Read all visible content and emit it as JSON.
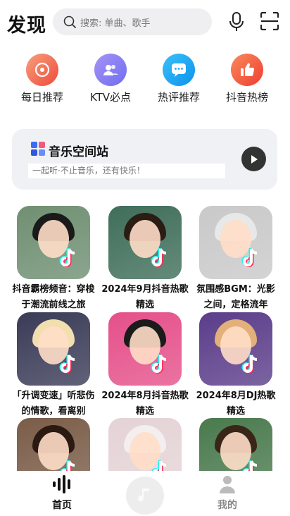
{
  "header": {
    "title": "发现",
    "search_placeholder": "搜索: 单曲、歌手"
  },
  "shortcuts": [
    {
      "label": "每日推荐",
      "color": "#f0603f"
    },
    {
      "label": "KTV必点",
      "color": "#8d7cf3"
    },
    {
      "label": "热评推荐",
      "color": "#1aa7f4"
    },
    {
      "label": "抖音热榜",
      "color": "#f4593c"
    }
  ],
  "station": {
    "title": "音乐空间站",
    "subtitle": "一起听·不止音乐，还有快乐！"
  },
  "playlists": [
    {
      "name": "抖音霸榜频音：穿梭于潮流前线之旅",
      "bg": "#6f8f72",
      "hair": "#1a1a1a"
    },
    {
      "name": "2024年9月抖音热歌精选",
      "bg": "#3f6e5a",
      "hair": "#2b1c14"
    },
    {
      "name": "氛围感BGM：光影之间，定格流年",
      "bg": "#c9c9c9",
      "hair": "#e8e8e8"
    },
    {
      "name": "「升调变速」听悲伤的情歌，看离别",
      "bg": "#3a3b57",
      "hair": "#f2dfb0"
    },
    {
      "name": "2024年8月抖音热歌精选",
      "bg": "#e5508a",
      "hair": "#1b1b1b"
    },
    {
      "name": "2024年8月DJ热歌精选",
      "bg": "#5b3d8a",
      "hair": "#e3b07a"
    },
    {
      "name": "",
      "bg": "#7a5d48",
      "hair": "#2a1a12"
    },
    {
      "name": "",
      "bg": "#e4d3d6",
      "hair": "#f3eef0"
    },
    {
      "name": "",
      "bg": "#4a7a4e",
      "hair": "#3a2618"
    }
  ],
  "tabbar": {
    "home": "首页",
    "mine": "我的"
  }
}
